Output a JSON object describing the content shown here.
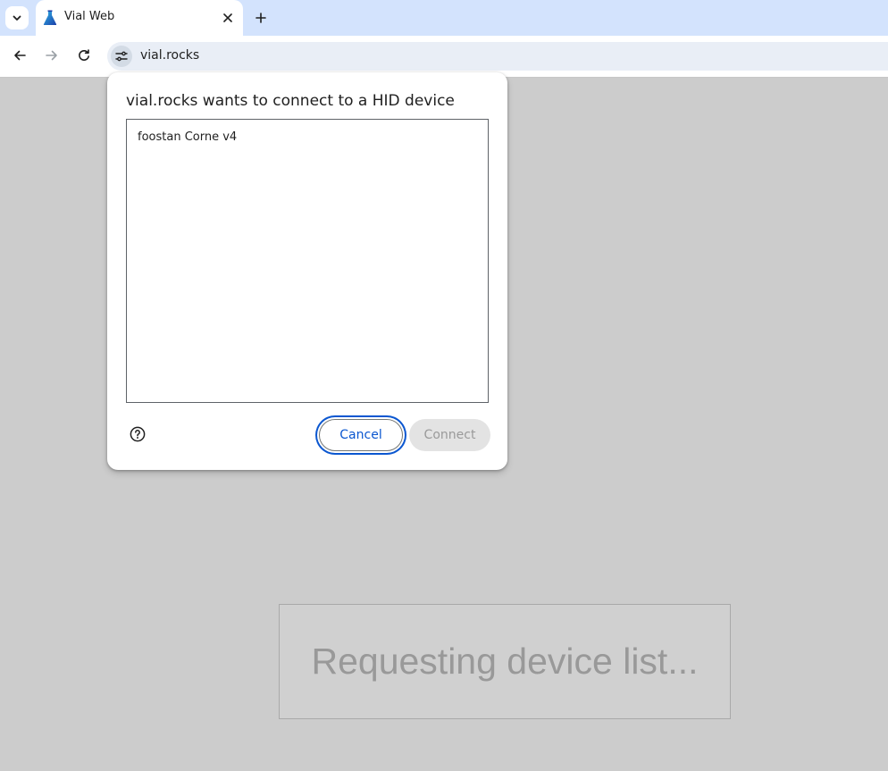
{
  "browser": {
    "tab": {
      "title": "Vial Web",
      "favicon": "flask-icon"
    },
    "url": "vial.rocks"
  },
  "dialog": {
    "title": "vial.rocks wants to connect to a HID device",
    "devices": [
      {
        "label": "foostan Corne v4"
      }
    ],
    "cancel_label": "Cancel",
    "connect_label": "Connect"
  },
  "page": {
    "status_text": "Requesting device list..."
  },
  "colors": {
    "tabstrip_bg": "#d3e3fd",
    "page_bg": "#cccccc",
    "accent": "#0b57d0",
    "disabled_text": "#9a9a9a"
  }
}
